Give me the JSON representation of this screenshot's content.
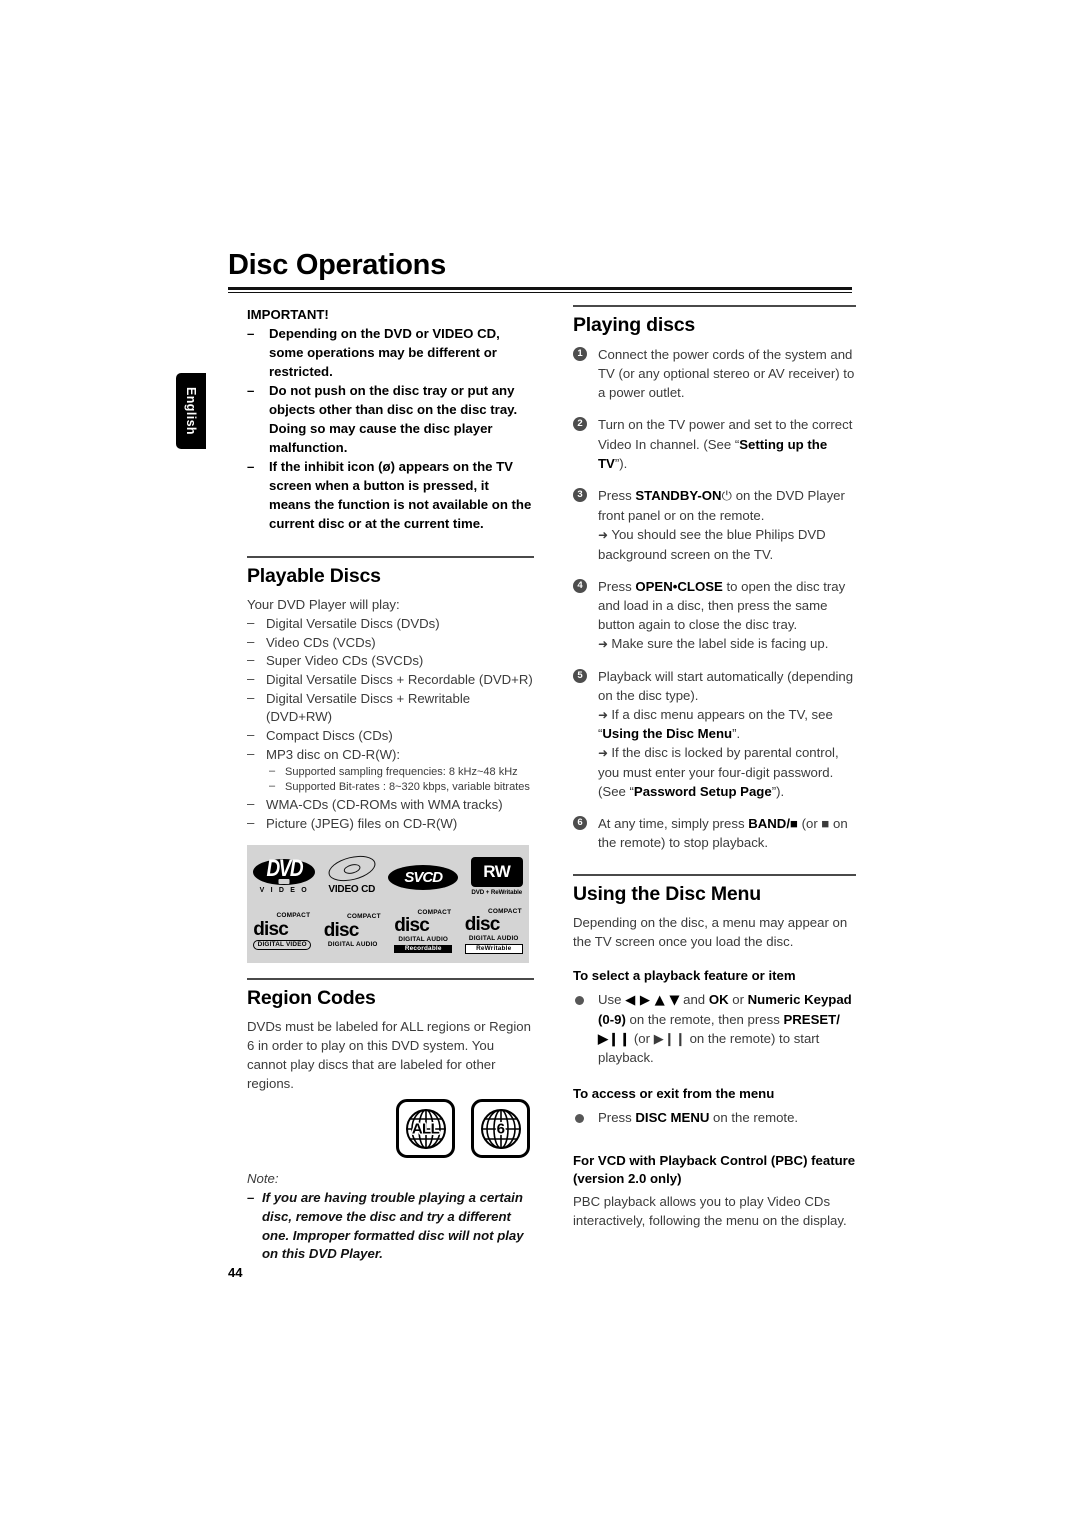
{
  "page": {
    "title": "Disc Operations",
    "page_number": "44",
    "language_tab": "English"
  },
  "left_column": {
    "important": {
      "heading": "IMPORTANT!",
      "items": [
        "Depending on the DVD or VIDEO CD, some operations may be different or restricted.",
        "Do not push on the disc tray or put any objects other than disc on the disc tray. Doing so may cause the disc player malfunction.",
        "If the inhibit icon (ø) appears on the TV screen when a button is pressed, it means the function is not available on the current disc or at the current time."
      ]
    },
    "playable_discs": {
      "heading": "Playable Discs",
      "intro": "Your DVD Player will play:",
      "items": [
        "Digital Versatile Discs (DVDs)",
        "Video CDs (VCDs)",
        "Super Video CDs (SVCDs)",
        "Digital Versatile Discs + Recordable (DVD+R)",
        "Digital Versatile Discs + Rewritable (DVD+RW)",
        "Compact Discs (CDs)",
        "MP3 disc on CD-R(W):"
      ],
      "sub_items": [
        "Supported sampling frequencies: 8 kHz~48 kHz",
        "Supported Bit-rates : 8~320 kbps, variable bitrates"
      ],
      "items_after": [
        "WMA-CDs (CD-ROMs with  WMA tracks)",
        "Picture (JPEG) files on CD-R(W)"
      ],
      "logos": [
        {
          "name": "dvd-video-logo",
          "main": "DVD",
          "sub": "V I D E O"
        },
        {
          "name": "video-cd-logo",
          "main": "",
          "sub": "VIDEO CD"
        },
        {
          "name": "svcd-logo",
          "main": "SVCD",
          "sub": ""
        },
        {
          "name": "dvd-rewritable-logo",
          "main": "RW",
          "sub": "DVD + ReWritable"
        },
        {
          "name": "compact-disc-digital-video-logo",
          "top": "COMPACT",
          "main": "disc",
          "sub": "DIGITAL VIDEO"
        },
        {
          "name": "compact-disc-digital-audio-logo",
          "top": "COMPACT",
          "main": "disc",
          "sub": "DIGITAL AUDIO"
        },
        {
          "name": "compact-disc-recordable-logo",
          "top": "COMPACT",
          "main": "disc",
          "sub": "DIGITAL AUDIO",
          "sub2": "Recordable"
        },
        {
          "name": "compact-disc-rewritable-logo",
          "top": "COMPACT",
          "main": "disc",
          "sub": "DIGITAL AUDIO",
          "sub2": "ReWritable"
        }
      ]
    },
    "region_codes": {
      "heading": "Region Codes",
      "body": "DVDs must be labeled for ALL regions or Region 6 in order to play on this DVD system. You cannot play discs that are labeled for other regions.",
      "icons": [
        "ALL",
        "6"
      ],
      "note_label": "Note:",
      "note_body": "If you are having trouble playing a certain disc, remove the disc and try a different one. Improper formatted disc will not play on this DVD Player."
    }
  },
  "right_column": {
    "playing_discs": {
      "heading": "Playing discs",
      "steps": [
        {
          "num": "1",
          "text": "Connect the power cords of the system and TV (or any optional stereo or AV receiver) to a power outlet."
        },
        {
          "num": "2",
          "pre": "Turn on the TV power and set to the correct Video In channel. (See “",
          "bold": "Setting up the TV",
          "post": "”)."
        },
        {
          "num": "3",
          "pre": "Press ",
          "bold": "STANDBY-ON",
          "post": " on the DVD Player front panel or  on the remote.",
          "arrows": [
            "You should see the blue Philips DVD background screen on the TV."
          ]
        },
        {
          "num": "4",
          "pre": "Press ",
          "bold": "OPEN•CLOSE",
          "post": " to open the disc tray and load in a disc, then press the same button again to close the disc tray.",
          "arrows": [
            "Make sure the label side is facing up."
          ]
        },
        {
          "num": "5",
          "text": "Playback will start automatically (depending on the disc type).",
          "arrows_rich": [
            {
              "pre": "If a disc menu appears on the TV, see “",
              "bold": "Using the Disc Menu",
              "post": "”."
            },
            {
              "pre": "If the disc is locked by parental control, you must enter your four-digit password. (See “",
              "bold": "Password Setup Page",
              "post": "”)."
            }
          ]
        },
        {
          "num": "6",
          "pre": "At any time, simply press ",
          "bold": "BAND/■",
          "post": " (or ■ on the remote) to stop playback."
        }
      ]
    },
    "using_disc_menu": {
      "heading": "Using the Disc Menu",
      "intro": "Depending on the disc, a menu may appear on the TV screen once you load the disc.",
      "sub1": {
        "heading": "To select a playback feature or item",
        "bullet_pre": "Use ",
        "bullet_keys": "◀ ▶ ▲ ▼",
        "bullet_mid": " and ",
        "bullet_bold1": "OK",
        "bullet_mid2": " or ",
        "bullet_bold2": "Numeric Keypad (0-9)",
        "bullet_mid3": " on the remote, then press ",
        "bullet_bold3": "PRESET/ ▶❙❙",
        "bullet_mid4": " (or  ▶❙❙  on the remote) to start playback."
      },
      "sub2": {
        "heading": "To access or exit from the menu",
        "bullet_pre": "Press ",
        "bullet_bold": "DISC MENU",
        "bullet_post": " on the remote."
      },
      "sub3": {
        "heading": "For VCD with Playback Control (PBC) feature (version 2.0 only)",
        "body": "PBC playback allows you to play Video CDs interactively, following the menu on the display."
      }
    }
  }
}
